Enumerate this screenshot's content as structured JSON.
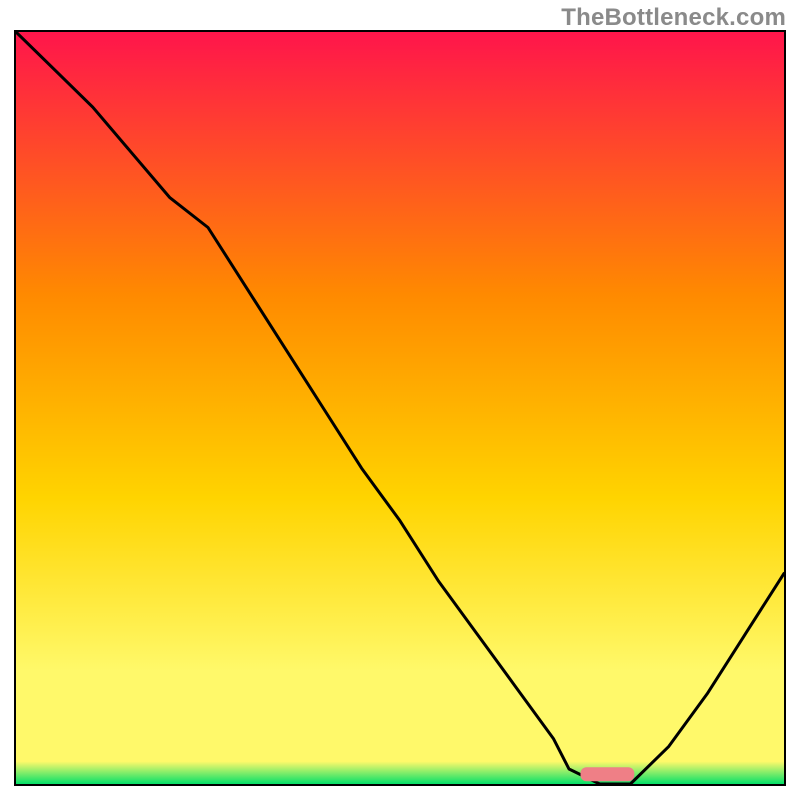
{
  "watermark": "TheBottleneck.com",
  "chart_data": {
    "type": "line",
    "title": "",
    "xlabel": "",
    "ylabel": "",
    "xlim": [
      0,
      100
    ],
    "ylim": [
      0,
      100
    ],
    "grid": false,
    "legend": false,
    "background_gradient": {
      "top": "#ff154b",
      "mid_high": "#ff8a00",
      "mid": "#ffd400",
      "mid_low": "#fff96a",
      "low": "#04e069"
    },
    "series": [
      {
        "name": "bottleneck-curve",
        "color": "#000000",
        "x": [
          0,
          5,
          10,
          15,
          20,
          25,
          30,
          35,
          40,
          45,
          50,
          55,
          60,
          65,
          70,
          72,
          76,
          80,
          85,
          90,
          95,
          100
        ],
        "y": [
          100,
          95,
          90,
          84,
          78,
          74,
          66,
          58,
          50,
          42,
          35,
          27,
          20,
          13,
          6,
          2,
          0,
          0,
          5,
          12,
          20,
          28
        ]
      }
    ],
    "marker": {
      "name": "optimal-zone",
      "shape": "rounded-bar",
      "color": "#ef7f86",
      "x_center": 77,
      "width_pct": 7,
      "y": 1.3
    }
  }
}
